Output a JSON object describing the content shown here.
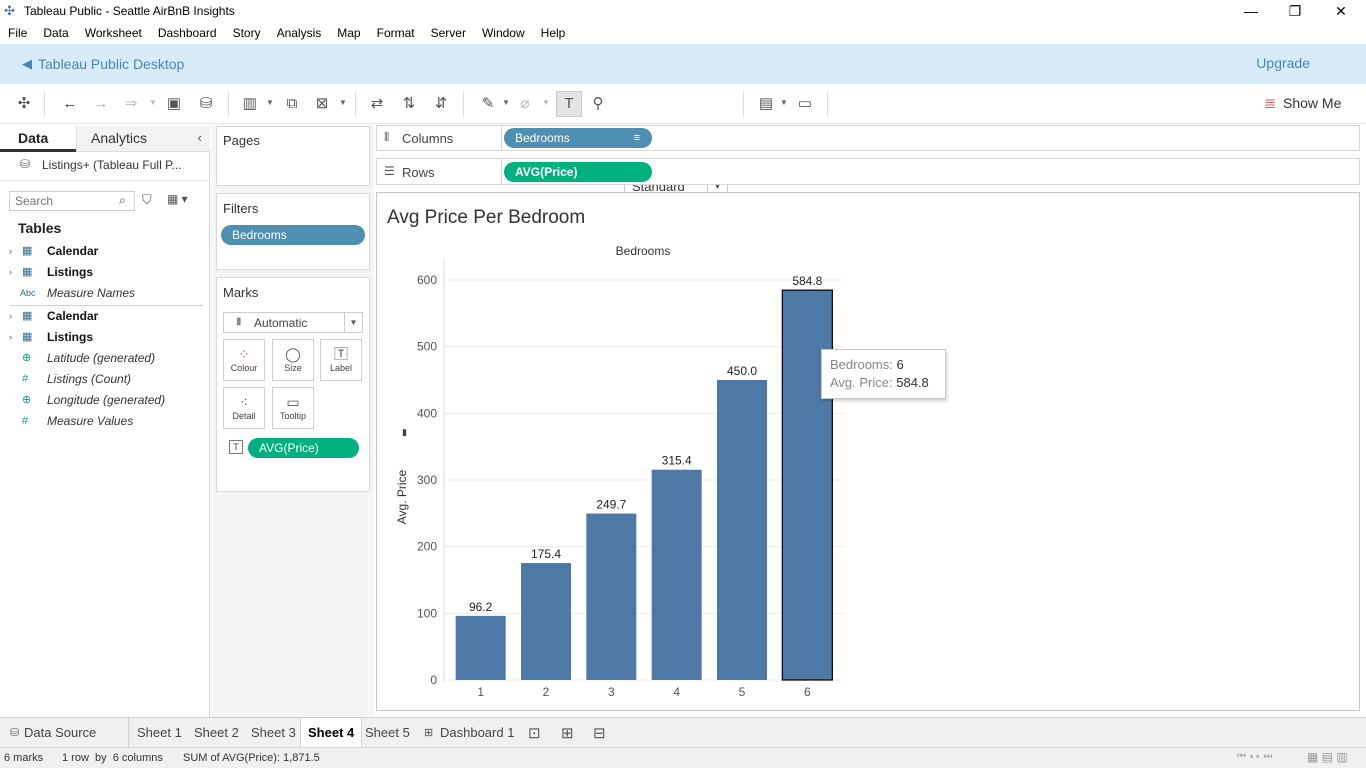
{
  "window": {
    "title": "Tableau Public - Seattle AirBnB Insights"
  },
  "menu": [
    "File",
    "Data",
    "Worksheet",
    "Dashboard",
    "Story",
    "Analysis",
    "Map",
    "Format",
    "Server",
    "Window",
    "Help"
  ],
  "banner": {
    "title": "Tableau Public Desktop",
    "upgrade": "Upgrade"
  },
  "toolbar": {
    "fit": "Standard",
    "show_me": "Show Me"
  },
  "left_pane": {
    "tab_data": "Data",
    "tab_analytics": "Analytics",
    "datasource": "Listings+ (Tableau Full P...",
    "search_placeholder": "Search",
    "tables_heading": "Tables",
    "items": [
      {
        "label": "Calendar",
        "icon": "table-icon",
        "bold": true
      },
      {
        "label": "Listings",
        "icon": "table-icon",
        "bold": true
      },
      {
        "label": "Measure Names",
        "icon": "abc-icon",
        "bold": false
      },
      {
        "label": "Calendar",
        "icon": "table-icon",
        "bold": true
      },
      {
        "label": "Listings",
        "icon": "table-icon",
        "bold": true
      },
      {
        "label": "Latitude (generated)",
        "icon": "globe-icon",
        "bold": false
      },
      {
        "label": "Listings (Count)",
        "icon": "hash-icon",
        "bold": false
      },
      {
        "label": "Longitude (generated)",
        "icon": "globe-icon",
        "bold": false
      },
      {
        "label": "Measure Values",
        "icon": "hash-icon",
        "bold": false
      }
    ]
  },
  "cards": {
    "pages": "Pages",
    "filters": "Filters",
    "filter_pill": "Bedrooms",
    "marks": "Marks",
    "mark_type": "Automatic",
    "mark_buttons": [
      "Colour",
      "Size",
      "Label",
      "Detail",
      "Tooltip"
    ],
    "marks_pill": "AVG(Price)"
  },
  "shelves": {
    "columns_label": "Columns",
    "columns_pill": "Bedrooms",
    "rows_label": "Rows",
    "rows_pill": "AVG(Price)"
  },
  "chart_data": {
    "type": "bar",
    "title": "Avg Price Per Bedroom",
    "xlabel": "Bedrooms",
    "ylabel": "Avg. Price",
    "categories": [
      "1",
      "2",
      "3",
      "4",
      "5",
      "6"
    ],
    "values": [
      96.2,
      175.4,
      249.7,
      315.4,
      450.0,
      584.8
    ],
    "data_labels": [
      "96.2",
      "175.4",
      "249.7",
      "315.4",
      "450.0",
      "584.8"
    ],
    "ylim": [
      0,
      630
    ],
    "yticks": [
      0,
      100,
      200,
      300,
      400,
      500,
      600
    ],
    "bar_color": "#4e79a7",
    "selected_index": 5
  },
  "tooltip": {
    "k1": "Bedrooms:",
    "v1": "6",
    "k2": "Avg. Price:",
    "v2": "584.8"
  },
  "sheet_tabs": [
    "Data Source",
    "Sheet 1",
    "Sheet 2",
    "Sheet 3",
    "Sheet 4",
    "Sheet 5",
    "Dashboard 1"
  ],
  "active_tab": "Sheet 4",
  "status": {
    "marks": "6 marks",
    "dims": "1 row  by  6 columns",
    "sum": "SUM of AVG(Price): 1,871.5"
  }
}
